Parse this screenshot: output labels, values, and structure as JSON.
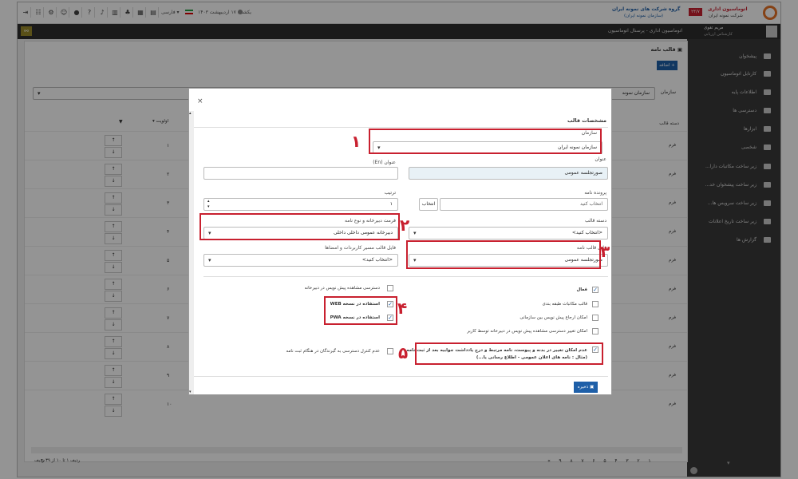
{
  "topbar": {
    "brand_line1": "گروه شرکت های نمونه ایران",
    "brand_line2": "(سازمان نمونه ایران)",
    "brand_badge": "۲۴/۷",
    "automation_line1": "اتوماسیون اداری",
    "automation_line2": "شرکت نمونه ایران",
    "date_text": "یکشنبه ۱۷ اردیبهشت ۱۴۰۳",
    "lang_text": "فارسی"
  },
  "darkbar": {
    "user_name": "مریم تقوی",
    "user_role": "کارشناس ارزیابی",
    "breadcrumb": "اتوماسیون اداری - پرسنال اتوماسیون"
  },
  "sidebar": {
    "items": [
      {
        "label": "پیشخوان",
        "icon": "home-icon"
      },
      {
        "label": "کارتابل اتوماسیون",
        "icon": "inbox-icon"
      },
      {
        "label": "اطلاعات پایه",
        "icon": "folder-icon"
      },
      {
        "label": "دسترسی ها",
        "icon": "folder-icon"
      },
      {
        "label": "ابزارها",
        "icon": "folder-icon"
      },
      {
        "label": "شخصی",
        "icon": "folder-icon"
      },
      {
        "label": "زیر ساخت مکاتبات دارا...",
        "icon": "folder-icon"
      },
      {
        "label": "زیر ساخت پیشخوان خد...",
        "icon": "folder-icon"
      },
      {
        "label": "زیر ساخت سرویس ها...",
        "icon": "folder-icon"
      },
      {
        "label": "زیر ساخت تاریخ اعلانات",
        "icon": "folder-icon"
      },
      {
        "label": "گزارش ها",
        "icon": "folder-icon"
      }
    ]
  },
  "content": {
    "panel_title": "قالب نامه",
    "add_button": "اضافه",
    "org_label": "سازمان",
    "org_value": "سازمان نمونه",
    "col_category": "دسته قالب",
    "col_order": "اولویت",
    "row_orders": [
      "۱",
      "۲",
      "۳",
      "۴",
      "۵",
      "۶",
      "۷",
      "۸",
      "۹",
      "۱۰"
    ],
    "row_labels": [
      "فرم",
      "فرم",
      "فرم",
      "فرم",
      "فرم",
      "فرم",
      "فرم",
      "فرم",
      "فرم",
      "فرم"
    ],
    "footer_text": "ردیف ۱ تا ۱۰ از ۳۹ ردیف",
    "pager": [
      "۱",
      "۲",
      "۳",
      "۴",
      "۵",
      "۶",
      "۷",
      "۸",
      "۹",
      "»"
    ]
  },
  "modal": {
    "title": "مشخصات قالب",
    "org_label": "سازمان",
    "org_value": "سازمان نمونه ایران",
    "title_label": "عنوان",
    "title_value": "صورتجلسه عمومی",
    "title_en_label": "عنوان (En)",
    "title_en_value": "",
    "folder_label": "پرونده نامه",
    "folder_placeholder": "انتخاب کنید",
    "folder_button": "انتخاب",
    "order_label": "ترتیب",
    "order_value": "۱",
    "category_label": "دسته قالب",
    "category_value": "<انتخاب کنید>",
    "secretariat_label": "فرمت دبیرخانه و نوع نامه",
    "secretariat_value": "دبیرخانه عمومی داخلی داخلی",
    "template_file_label": "فایل قالب نامه",
    "template_file_value": "صورتجلسه عمومی",
    "signature_label": "فایل قالب مسیر کاربردات و امضاها",
    "signature_value": "<انتخاب کنید>",
    "checks_right": [
      {
        "label": "فعال",
        "checked": true
      },
      {
        "label": "قالب مکاتبات طبقه بندی",
        "checked": false
      },
      {
        "label": "امکان ارجاع پیش نویس بین سازمانی",
        "checked": false
      },
      {
        "label": "امکان تغییر دسترسی مشاهده پیش نویس در دبیرخانه توسط کاربر",
        "checked": false
      }
    ],
    "checks_left": [
      {
        "label": "دسترسی مشاهده پیش نویس در دبیرخانه",
        "checked": false
      },
      {
        "label": "استفاده در نسخه WEB",
        "checked": true
      },
      {
        "label": "استفاده در نسخه PWA",
        "checked": true
      }
    ],
    "check_long_line1": "عدم امکان تغییر در بدنه و پیوست، نامه مرتبط و درج یادداشت جوابیه بعد از ثبت نامه",
    "check_long_line2": "(مثال : نامه های اعلان عمومی - اطلاع رسانی یا...)",
    "check_receiver": "عدم کنترل دسترسی به گیرندگان در هنگام ثبت نامه",
    "save_button": "ذخیره",
    "close_symbol": "×"
  },
  "annotations": [
    "۱",
    "۲",
    "۳",
    "۴",
    "۵"
  ],
  "colors": {
    "accent": "#1e5fa8",
    "annotation": "#c8202f",
    "dark_bar": "#2d2d2d",
    "sidebar": "#3a3a3a"
  }
}
